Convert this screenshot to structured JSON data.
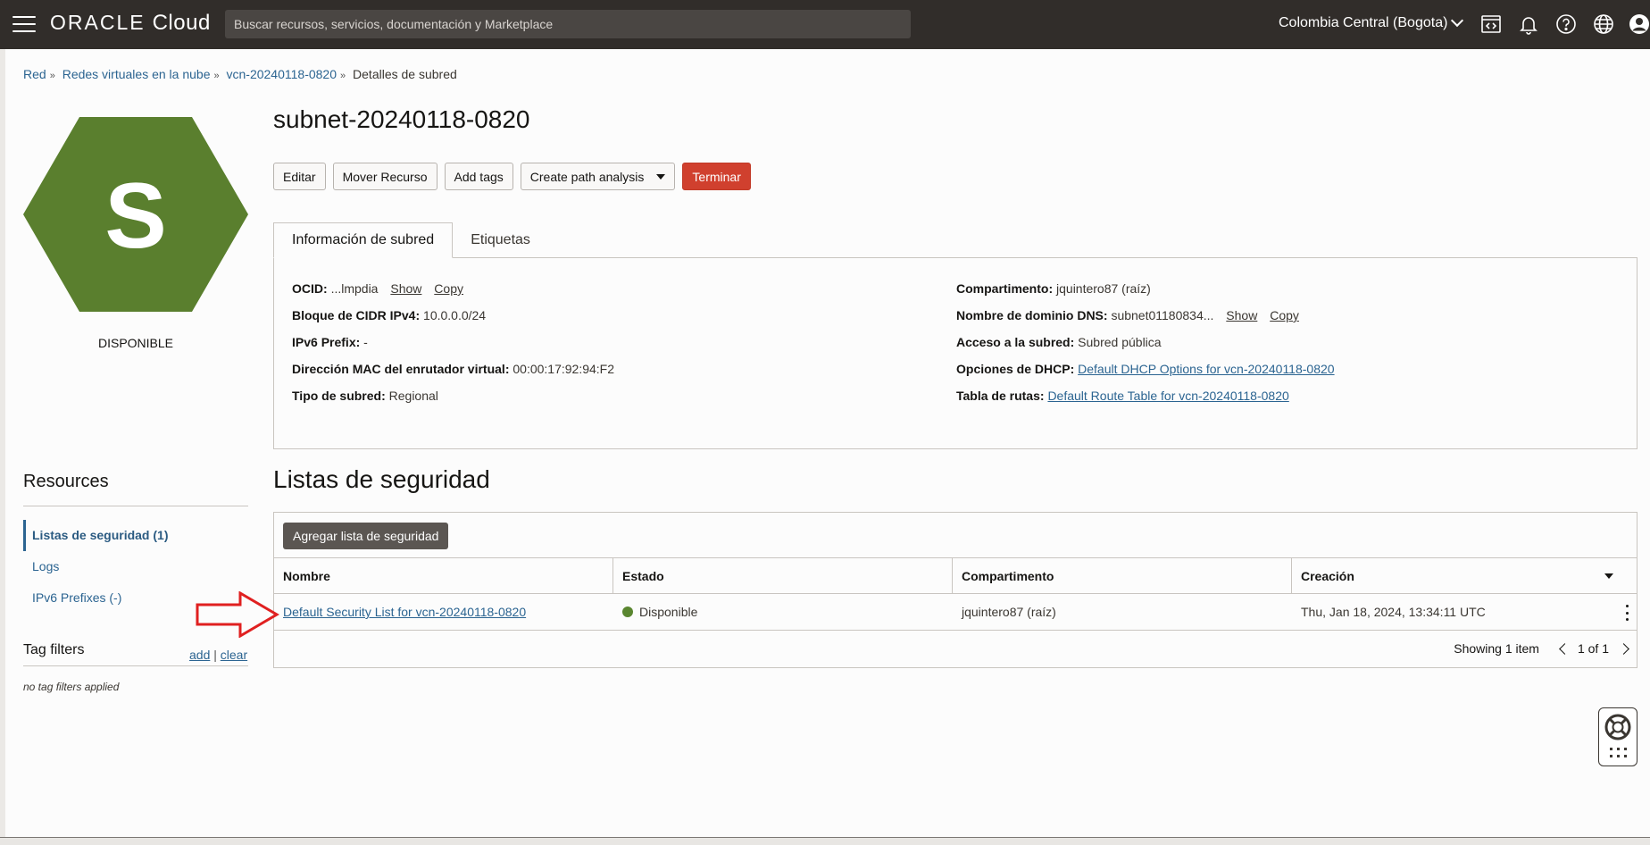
{
  "topbar": {
    "brand": "ORACLE",
    "product": "Cloud",
    "search_placeholder": "Buscar recursos, servicios, documentación y Marketplace",
    "region": "Colombia Central (Bogota)",
    "icons": [
      "code-editor-icon",
      "bell-icon",
      "help-icon",
      "globe-icon",
      "user-icon"
    ]
  },
  "breadcrumb": {
    "items": [
      "Red",
      "Redes virtuales en la nube",
      "vcn-20240118-0820"
    ],
    "current": "Detalles de subred",
    "separator": "»"
  },
  "resource": {
    "initial": "S",
    "status": "DISPONIBLE",
    "status_color": "#5a8630"
  },
  "title": "subnet-20240118-0820",
  "actions": {
    "edit": "Editar",
    "move": "Mover Recurso",
    "tags": "Add tags",
    "path_analysis": "Create path analysis",
    "terminate": "Terminar"
  },
  "tabs": [
    "Información de subred",
    "Etiquetas"
  ],
  "info": {
    "left": [
      {
        "label": "OCID:",
        "value": "...lmpdia",
        "show": "Show",
        "copy": "Copy"
      },
      {
        "label": "Bloque de CIDR IPv4:",
        "value": "10.0.0.0/24"
      },
      {
        "label": "IPv6 Prefix:",
        "value": "-"
      },
      {
        "label": "Dirección MAC del enrutador virtual:",
        "value": "00:00:17:92:94:F2"
      },
      {
        "label": "Tipo de subred:",
        "value": "Regional"
      }
    ],
    "right": [
      {
        "label": "Compartimento:",
        "value": "jquintero87 (raíz)"
      },
      {
        "label": "Nombre de dominio DNS:",
        "value": "subnet01180834...",
        "show": "Show",
        "copy": "Copy"
      },
      {
        "label": "Acceso a la subred:",
        "value": "Subred pública"
      },
      {
        "label": "Opciones de DHCP:",
        "link": "Default DHCP Options for vcn-20240118-0820"
      },
      {
        "label": "Tabla de rutas:",
        "link": "Default Route Table for vcn-20240118-0820"
      }
    ]
  },
  "resources": {
    "title": "Resources",
    "items": [
      "Listas de seguridad (1)",
      "Logs",
      "IPv6 Prefixes (-)"
    ]
  },
  "tag_filters": {
    "title": "Tag filters",
    "add": "add",
    "sep": "|",
    "clear": "clear",
    "empty": "no tag filters applied"
  },
  "security": {
    "title": "Listas de seguridad",
    "add_button": "Agregar lista de seguridad",
    "columns": [
      "Nombre",
      "Estado",
      "Compartimento",
      "Creación"
    ],
    "rows": [
      {
        "name": "Default Security List for vcn-20240118-0820",
        "state": "Disponible",
        "compartment": "jquintero87 (raíz)",
        "created": "Thu, Jan 18, 2024, 13:34:11 UTC"
      }
    ],
    "showing": "Showing 1 item",
    "page": "1 of 1"
  },
  "colors": {
    "topbar": "#312d2a",
    "hex": "#5a7f2e",
    "link": "#2b6491",
    "danger": "#d0402e",
    "annotation_arrow": "#e02020"
  }
}
